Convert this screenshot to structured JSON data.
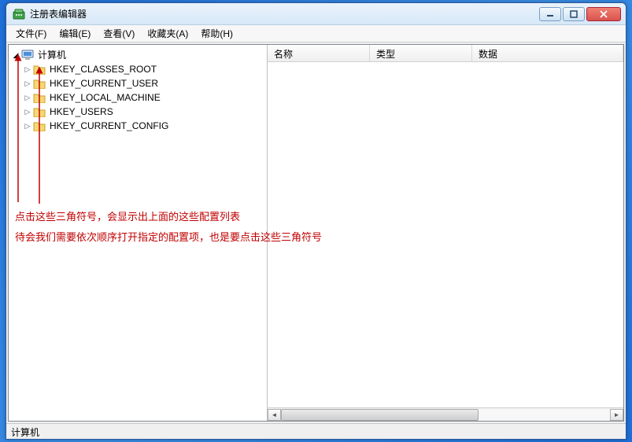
{
  "window": {
    "title": "注册表编辑器"
  },
  "menu": {
    "file": "文件(F)",
    "edit": "编辑(E)",
    "view": "查看(V)",
    "fav": "收藏夹(A)",
    "help": "帮助(H)"
  },
  "tree": {
    "root": "计算机",
    "items": [
      {
        "label": "HKEY_CLASSES_ROOT"
      },
      {
        "label": "HKEY_CURRENT_USER"
      },
      {
        "label": "HKEY_LOCAL_MACHINE"
      },
      {
        "label": "HKEY_USERS"
      },
      {
        "label": "HKEY_CURRENT_CONFIG"
      }
    ]
  },
  "columns": {
    "name": "名称",
    "type": "类型",
    "data": "数据"
  },
  "status": "计算机",
  "annotations": {
    "line1": "点击这些三角符号，会显示出上面的这些配置列表",
    "line2": "待会我们需要依次顺序打开指定的配置项，也是要点击这些三角符号"
  }
}
